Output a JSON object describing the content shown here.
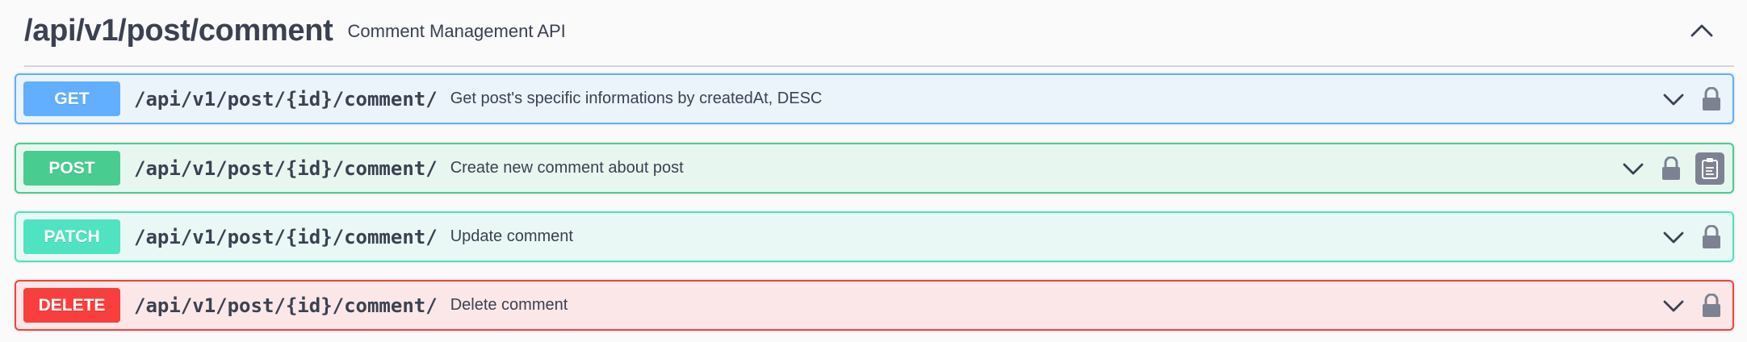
{
  "tag": {
    "title": "/api/v1/post/comment",
    "description": "Comment Management API",
    "toggle_icon": "chevron-up-icon"
  },
  "operations": [
    {
      "method": "GET",
      "path": "/api/v1/post/{id}/comment/",
      "summary": "Get post's specific informations by createdAt, DESC",
      "color": "#61affe",
      "background": "#ebf3fb"
    },
    {
      "method": "POST",
      "path": "/api/v1/post/{id}/comment/",
      "summary": "Create new comment about post",
      "color": "#49cc90",
      "background": "#e8f6f0"
    },
    {
      "method": "PATCH",
      "path": "/api/v1/post/{id}/comment/",
      "summary": "Update comment",
      "color": "#50e3c2",
      "background": "#e9f8f5"
    },
    {
      "method": "DELETE",
      "path": "/api/v1/post/{id}/comment/",
      "summary": "Delete comment",
      "color": "#f93e3e",
      "background": "#fbe7e7"
    }
  ],
  "icons": {
    "expand": "chevron-down-icon",
    "lock": "lock-icon",
    "copy": "clipboard-copy-icon"
  }
}
